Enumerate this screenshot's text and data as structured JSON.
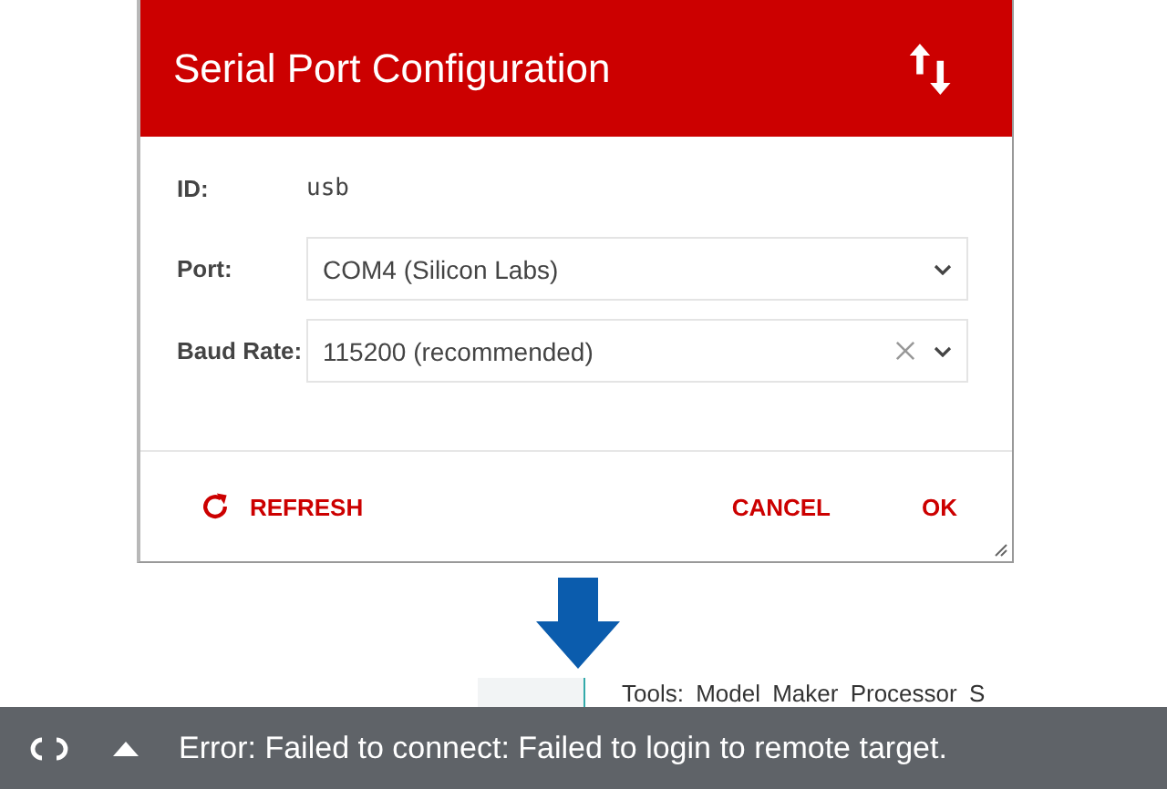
{
  "dialog": {
    "title": "Serial Port Configuration",
    "fields": [
      {
        "kind": "text",
        "label": "ID:",
        "value": "usb"
      },
      {
        "kind": "select",
        "label": "Port:",
        "value": "COM4 (Silicon Labs)",
        "clearable": false
      },
      {
        "kind": "select",
        "label": "Baud Rate:",
        "value": "115200 (recommended)",
        "clearable": true
      }
    ],
    "buttons": [
      {
        "kind": "refresh",
        "label": "REFRESH"
      },
      {
        "kind": "plain",
        "label": "CANCEL"
      },
      {
        "kind": "plain",
        "label": "OK"
      }
    ]
  },
  "background": {
    "tab_text": "Tools: Model Maker   Processor S"
  },
  "status_bar": {
    "message": "Error: Failed to connect: Failed to login to remote target."
  }
}
